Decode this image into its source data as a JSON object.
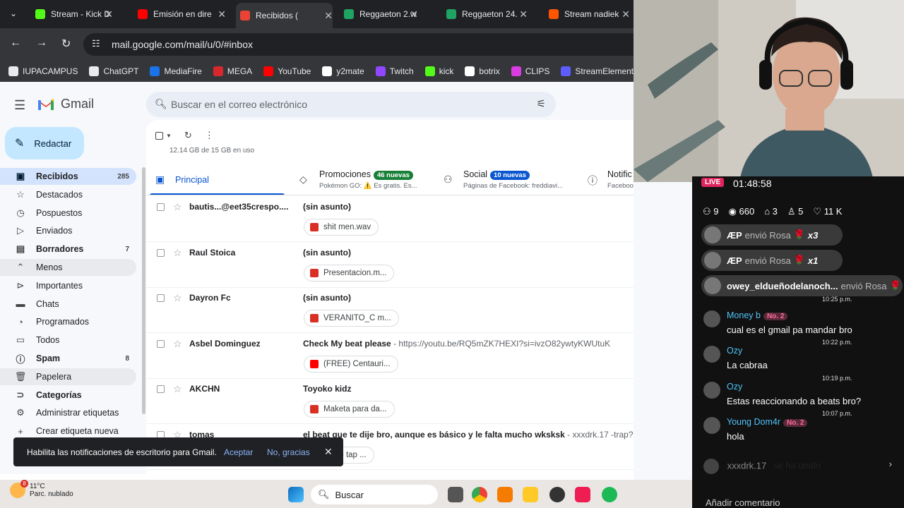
{
  "browser": {
    "tabs": [
      {
        "title": "Stream - Kick D",
        "color": "#53fc18"
      },
      {
        "title": "Emisión en dire",
        "color": "#ff0000"
      },
      {
        "title": "Recibidos (",
        "color": "#ea4335"
      },
      {
        "title": "Reggaeton 2.w",
        "color": "#1fa463"
      },
      {
        "title": "Reggaeton 24.",
        "color": "#1fa463"
      },
      {
        "title": "Stream nadiek",
        "color": "#ff5500"
      }
    ],
    "url": "mail.google.com/mail/u/0/#inbox",
    "bookmarks": [
      {
        "label": "IUPACAMPUS",
        "color": "#e8eaed"
      },
      {
        "label": "ChatGPT",
        "color": "#e8eaed"
      },
      {
        "label": "MediaFire",
        "color": "#1a73e8"
      },
      {
        "label": "MEGA",
        "color": "#d9272e"
      },
      {
        "label": "YouTube",
        "color": "#ff0000"
      },
      {
        "label": "y2mate",
        "color": "#ffffff"
      },
      {
        "label": "Twitch",
        "color": "#9146ff"
      },
      {
        "label": "kick",
        "color": "#53fc18"
      },
      {
        "label": "botrix",
        "color": "#ffffff"
      },
      {
        "label": "CLIPS",
        "color": "#d93ce0"
      },
      {
        "label": "StreamElements",
        "color": "#5d5dff"
      }
    ]
  },
  "gmail": {
    "app_name": "Gmail",
    "search_placeholder": "Buscar en el correo electrónico",
    "compose": "Redactar",
    "nav": [
      {
        "label": "Recibidos",
        "count": "285",
        "icon": "inbox-icon",
        "bold": true,
        "selected": true
      },
      {
        "label": "Destacados",
        "count": "",
        "icon": "star-icon"
      },
      {
        "label": "Pospuestos",
        "count": "",
        "icon": "clock-icon"
      },
      {
        "label": "Enviados",
        "count": "",
        "icon": "send-icon"
      },
      {
        "label": "Borradores",
        "count": "7",
        "icon": "draft-icon",
        "bold": true
      },
      {
        "label": "Menos",
        "count": "",
        "icon": "chevron-up-icon",
        "hover": true
      },
      {
        "label": "Importantes",
        "count": "",
        "icon": "important-icon"
      },
      {
        "label": "Chats",
        "count": "",
        "icon": "chat-icon"
      },
      {
        "label": "Programados",
        "count": "",
        "icon": "scheduled-icon"
      },
      {
        "label": "Todos",
        "count": "",
        "icon": "all-mail-icon"
      },
      {
        "label": "Spam",
        "count": "8",
        "icon": "spam-icon",
        "bold": true
      },
      {
        "label": "Papelera",
        "count": "",
        "icon": "trash-icon",
        "hover": true
      },
      {
        "label": "Categorías",
        "count": "",
        "icon": "label-icon",
        "bold": true
      },
      {
        "label": "Administrar etiquetas",
        "count": "",
        "icon": "settings-icon"
      },
      {
        "label": "Crear etiqueta nueva",
        "count": "",
        "icon": "plus-icon"
      }
    ],
    "storage": "12.14 GB de 15 GB en uso",
    "tabs": [
      {
        "label": "Principal",
        "sub": "",
        "badge": "",
        "badge_color": ""
      },
      {
        "label": "Promociones",
        "sub": "Pokémon GO: ⚠️ Es gratis. Es...",
        "badge": "46 nuevas",
        "badge_color": "#188038"
      },
      {
        "label": "Social",
        "sub": "Páginas de Facebook: freddiavi...",
        "badge": "10 nuevas",
        "badge_color": "#0b57d0"
      },
      {
        "label": "Notific",
        "sub": "Facebook: Tienes 11 notificac",
        "badge": "",
        "badge_color": ""
      }
    ],
    "emails": [
      {
        "sender": "bautis...@eet35crespo....",
        "subject": "(sin asunto)",
        "snippet": "",
        "attachment": "shit men.wav",
        "att_color": "#d93025"
      },
      {
        "sender": "Raul Stoica",
        "subject": "(sin asunto)",
        "snippet": "",
        "attachment": "Presentacion.m...",
        "att_color": "#d93025"
      },
      {
        "sender": "Dayron Fc",
        "subject": "(sin asunto)",
        "snippet": "",
        "attachment": "VERANITO_C m...",
        "att_color": "#d93025"
      },
      {
        "sender": "Asbel Dominguez",
        "subject": "Check My beat please",
        "snippet": " - https://youtu.be/RQ5mZK7HEXI?si=ivzO82ywtyKWUtuK",
        "attachment": "(FREE) Centauri...",
        "att_color": "#ff0000"
      },
      {
        "sender": "AKCHN",
        "subject": "Toyoko kidz",
        "snippet": "",
        "attachment": "Maketa para da...",
        "att_color": "#d93025"
      },
      {
        "sender": "tomas",
        "subject": "el beat que te dije bro, aunque es básico y le falta mucho wksksk",
        "snippet": " - xxxdrk.17 -trap?🤑",
        "attachment": "k.17 - tap ...",
        "att_color": "#d93025"
      }
    ],
    "toast": {
      "text": "Habilita las notificaciones de escritorio para Gmail.",
      "accept": "Aceptar",
      "decline": "No, gracias"
    }
  },
  "stream": {
    "live": "LIVE",
    "timer": "01:48:58",
    "stats": [
      {
        "icon": "users-icon",
        "value": "9"
      },
      {
        "icon": "eye-icon",
        "value": "660"
      },
      {
        "icon": "gift-icon",
        "value": "3"
      },
      {
        "icon": "follow-icon",
        "value": "5"
      },
      {
        "icon": "heart-icon",
        "value": "11 K"
      }
    ],
    "gifts": [
      {
        "user": "ÆP",
        "action": "envió Rosa",
        "mult": "x3"
      },
      {
        "user": "ÆP",
        "action": "envió Rosa",
        "mult": "x1"
      },
      {
        "user": "owey_eldueñodelanoch...",
        "action": "envió Rosa",
        "mult": ""
      }
    ],
    "messages": [
      {
        "user": "Money b",
        "level": "No. 2",
        "time": "10:25 p.m.",
        "text": "cual es el gmail pa mandar bro",
        "color": "#4fc3f7"
      },
      {
        "user": "Ozy",
        "level": "",
        "time": "10:22 p.m.",
        "text": "La cabraa",
        "color": "#4fc3f7"
      },
      {
        "user": "Ozy",
        "level": "",
        "time": "10:19 p.m.",
        "text": "Estas reaccionando a beats bro?",
        "color": "#4fc3f7"
      },
      {
        "user": "Young Dom4r",
        "level": "No. 2",
        "time": "10:07 p.m.",
        "text": "hola",
        "color": "#4fc3f7"
      }
    ],
    "joined_user": "xxxdrk.17",
    "joined_text": "se ha unido",
    "add_comment": "Añadir comentario"
  },
  "taskbar": {
    "temp": "11°C",
    "weather": "Parc. nublado",
    "notif": "8",
    "search": "Buscar"
  }
}
